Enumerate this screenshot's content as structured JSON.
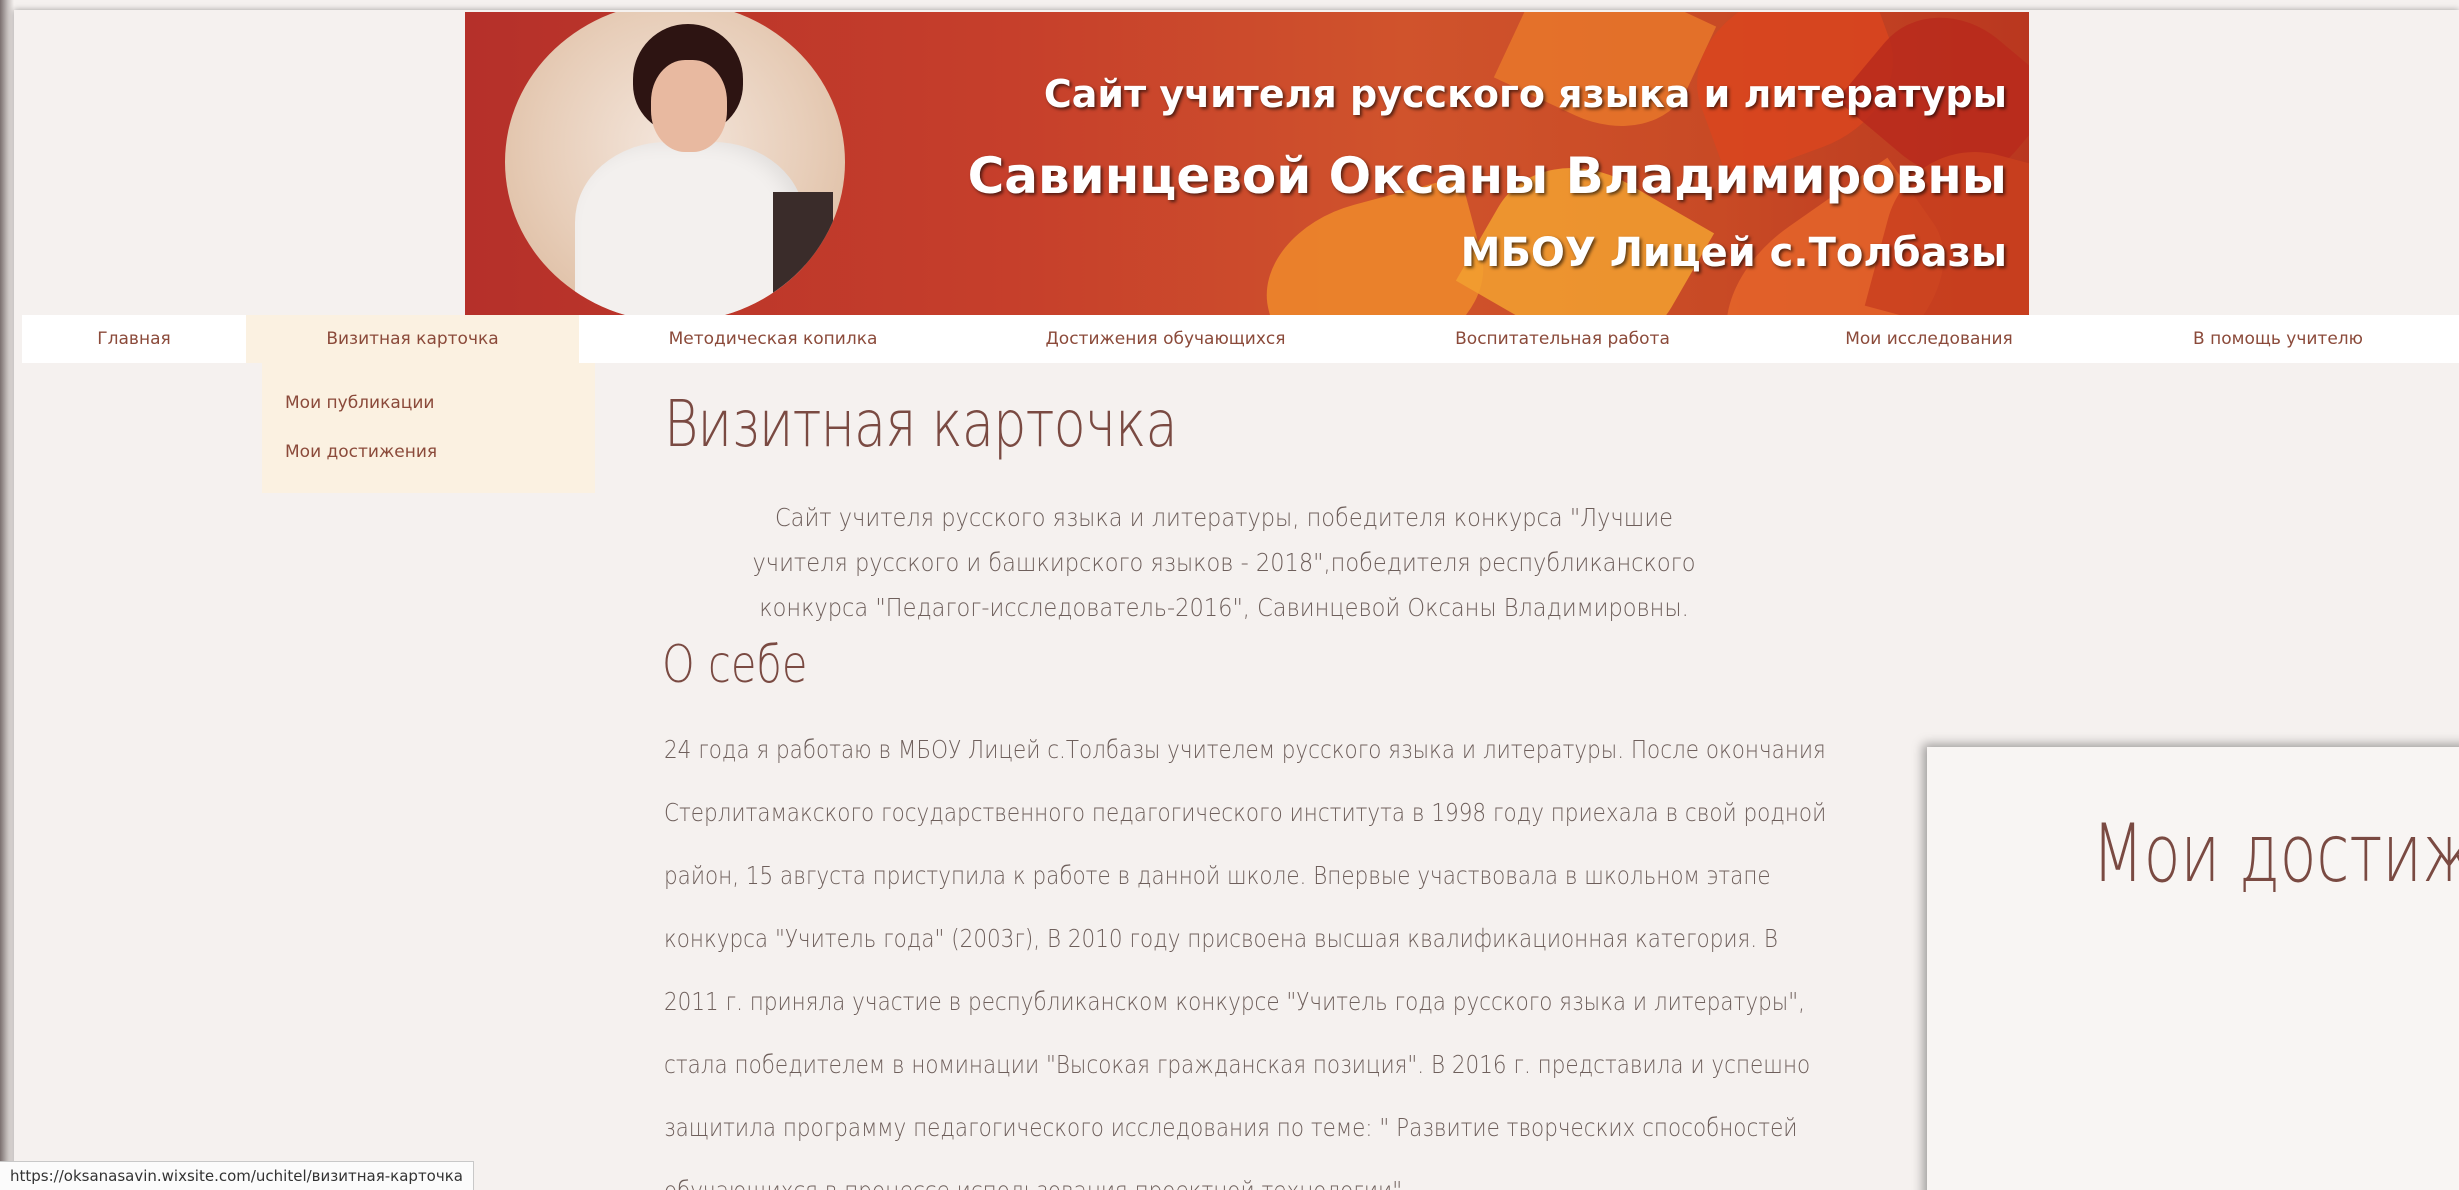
{
  "banner": {
    "line1": "Сайт учителя русского языка и литературы",
    "line2": "Савинцевой Оксаны Владимировны",
    "line3": "МБОУ Лицей с.Толбазы"
  },
  "nav": {
    "items": [
      {
        "label": "Главная"
      },
      {
        "label": "Визитная карточка"
      },
      {
        "label": "Методическая копилка"
      },
      {
        "label": "Достижения обучающихся"
      },
      {
        "label": "Воспитательная работа"
      },
      {
        "label": "Мои исследования"
      },
      {
        "label": "В помощь учителю"
      }
    ],
    "dropdown": [
      {
        "label": "Мои публикации"
      },
      {
        "label": "Мои достижения"
      }
    ]
  },
  "main": {
    "title": "Визитная карточка",
    "intro": "Сайт учителя русского языка и литературы, победителя конкурса \"Лучшие учителя русского и башкирского языков - 2018\",победителя республиканского конкурса \"Педагог-исследователь-2016\", Савинцевой Оксаны Владимировны.",
    "about_title": "О себе",
    "about_text": "24 года я работаю в МБОУ Лицей с.Толбазы учителем русского языка и литературы. После окончания Стерлитамакского государственного педагогического института в 1998 году приехала в свой родной район, 15 августа приступила к работе в данной школе. Впервые участвовала в школьном этапе конкурса \"Учитель года\" (2003г), В 2010 году присвоена высшая квалификационная категория. В 2011 г. приняла участие в республиканском конкурсе \"Учитель года русского языка и литературы\", стала победителем в номинации \"Высокая гражданская позиция\". В 2016 г. представила и успешно защитила программу педагогического исследования по теме: \" Развитие творческих способностей обучающихся в процессе использования проектной технологии\""
  },
  "side_panel": {
    "title": "Мои достиж"
  },
  "status_bar": {
    "url": "https://oksanasavin.wixsite.com/uchitel/визитная-карточка"
  },
  "colors": {
    "accent": "#8b4a3a",
    "banner_red": "#c63f2b",
    "page_bg": "#f5f1ef",
    "dropdown_bg": "#fbf1e1"
  }
}
